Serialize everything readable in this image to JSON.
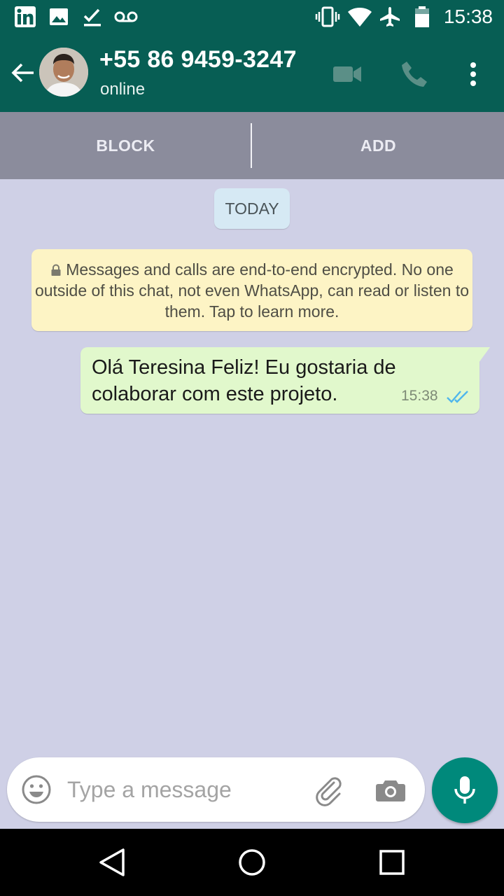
{
  "status_bar": {
    "time": "15:38",
    "left_icons": [
      "linkedin-icon",
      "image-icon",
      "check-icon",
      "voicemail-icon"
    ],
    "right_icons": [
      "vibrate-icon",
      "wifi-icon",
      "airplane-icon",
      "battery-icon"
    ]
  },
  "header": {
    "contact_name": "+55 86 9459-3247",
    "contact_status": "online",
    "icons": [
      "back-arrow-icon",
      "avatar",
      "video-call-icon",
      "phone-icon",
      "more-vert-icon"
    ]
  },
  "actions": {
    "block_label": "BLOCK",
    "add_label": "ADD"
  },
  "chat": {
    "date_label": "TODAY",
    "encryption_notice": "Messages and calls are end-to-end encrypted. No one outside of this chat, not even WhatsApp, can read or listen to them. Tap to learn more.",
    "messages": [
      {
        "direction": "outgoing",
        "text": "Olá Teresina Feliz! Eu gostaria de colaborar com este projeto.",
        "time": "15:38",
        "status": "delivered"
      }
    ]
  },
  "composer": {
    "placeholder": "Type a message",
    "icons": [
      "emoji-icon",
      "attach-icon",
      "camera-icon",
      "mic-icon"
    ]
  },
  "colors": {
    "header": "#075e54",
    "action_bar": "#8b8c9c",
    "chat_background": "#cfd0e6",
    "outgoing_bubble": "#e1f8cc",
    "notice_bubble": "#fdf4c5",
    "date_chip": "#d6e9f4",
    "mic_button": "#00897b",
    "ticks": "#4fb6ec"
  },
  "nav_bar": {
    "icons": [
      "nav-back-icon",
      "nav-home-icon",
      "nav-recents-icon"
    ]
  }
}
